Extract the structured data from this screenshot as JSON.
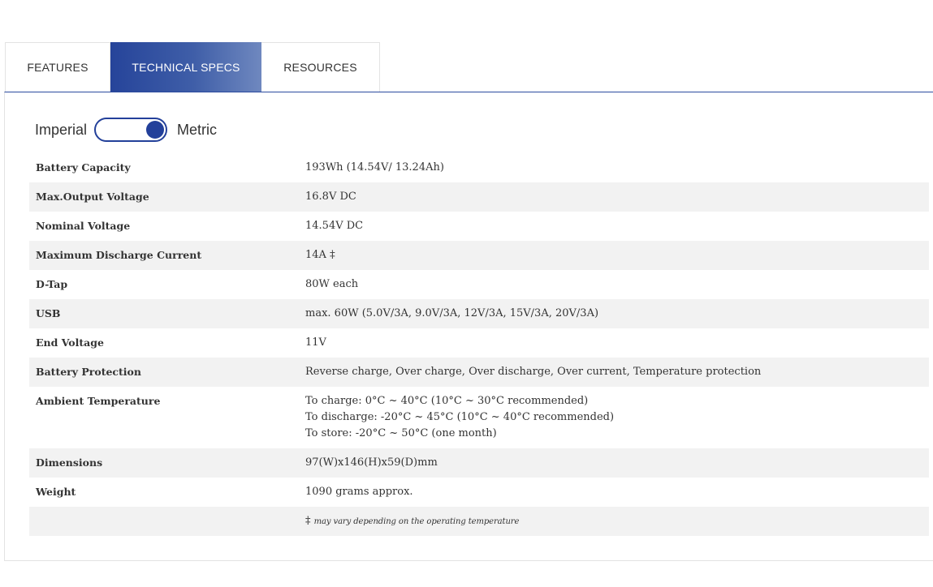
{
  "tabs": [
    {
      "label": "FEATURES",
      "active": false
    },
    {
      "label": "TECHNICAL SPECS",
      "active": true
    },
    {
      "label": "RESOURCES",
      "active": false
    }
  ],
  "units": {
    "left_label": "Imperial",
    "right_label": "Metric",
    "selected": "Metric"
  },
  "specs": [
    {
      "label": "Battery Capacity",
      "value": "193Wh (14.54V/ 13.24Ah)"
    },
    {
      "label": "Max.Output Voltage",
      "value": "16.8V DC"
    },
    {
      "label": "Nominal Voltage",
      "value": "14.54V DC"
    },
    {
      "label": "Maximum Discharge Current",
      "value": "14A ‡"
    },
    {
      "label": "D-Tap",
      "value": "80W each"
    },
    {
      "label": "USB",
      "value": " max. 60W (5.0V/3A, 9.0V/3A, 12V/3A, 15V/3A, 20V/3A)"
    },
    {
      "label": "End Voltage",
      "value": "11V"
    },
    {
      "label": "Battery Protection",
      "value": "Reverse charge, Over charge, Over discharge, Over current, Temperature protection"
    },
    {
      "label": "Ambient Temperature",
      "lines": [
        "To charge: 0°C ~ 40°C (10°C ~ 30°C recommended)",
        "To discharge: -20°C ~ 45°C (10°C ~ 40°C recommended)",
        "To store: -20°C ~ 50°C (one month)"
      ]
    },
    {
      "label": "Dimensions",
      "value": "97(W)x146(H)x59(D)mm"
    },
    {
      "label": "Weight",
      "value": "1090 grams approx."
    }
  ],
  "footnote": {
    "symbol": "‡",
    "text": "may vary depending on the operating temperature"
  }
}
